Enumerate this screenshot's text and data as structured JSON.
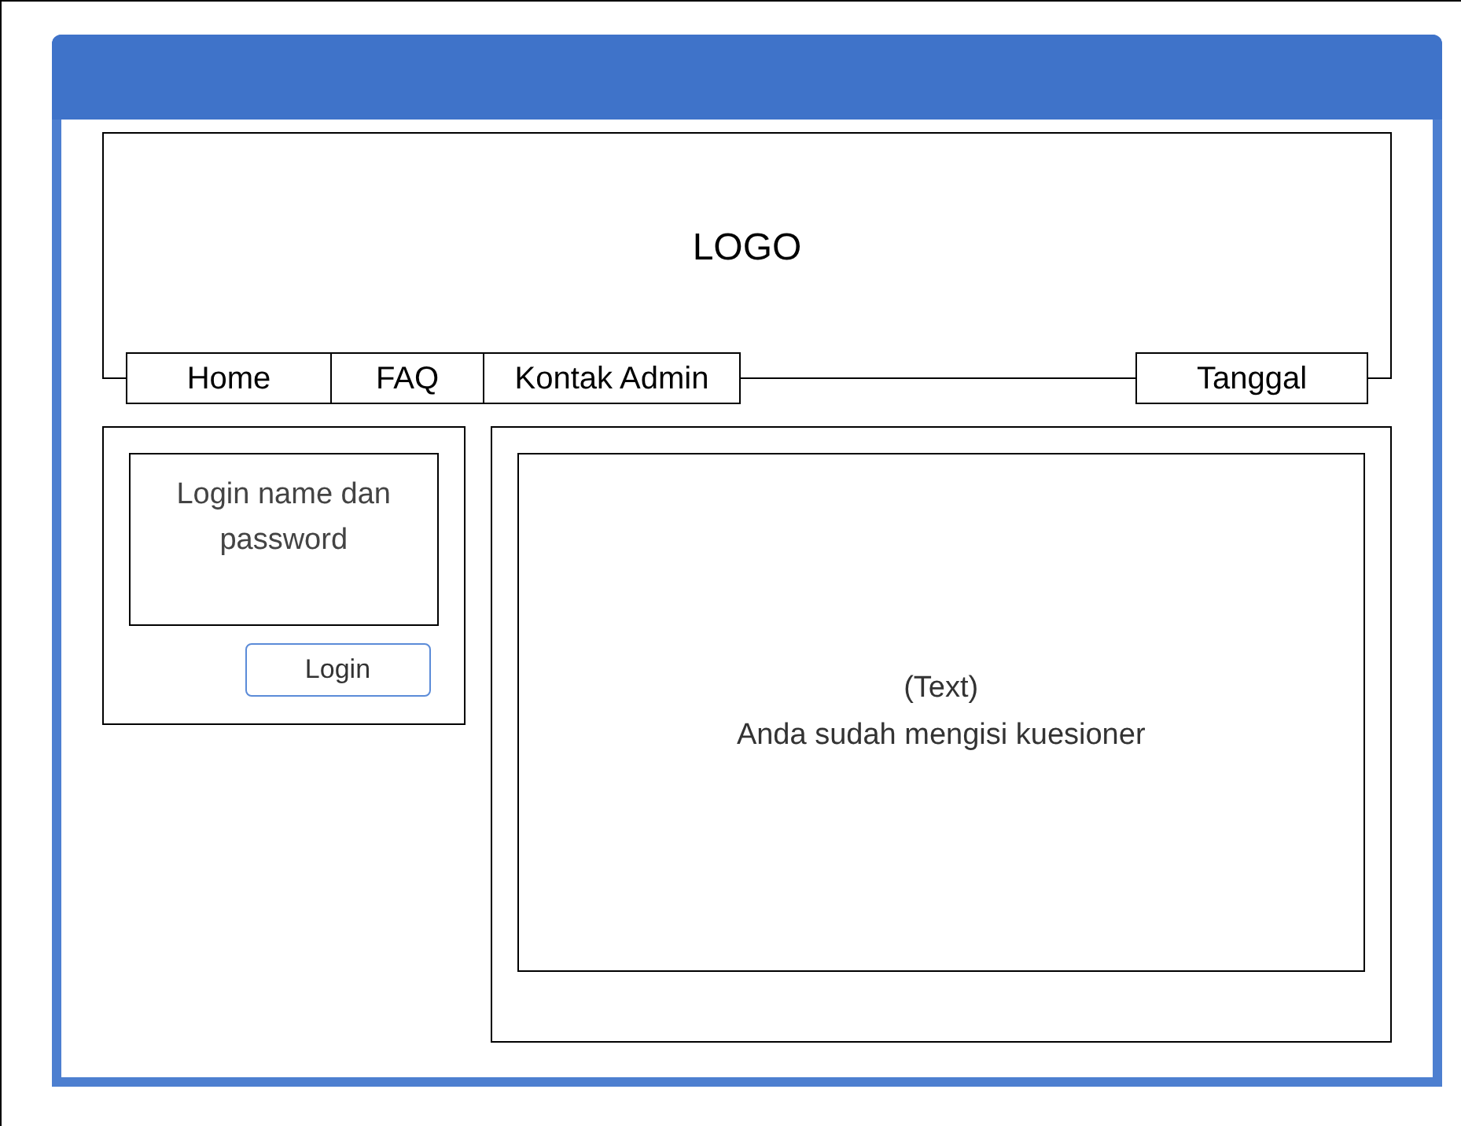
{
  "header": {
    "logo": "LOGO"
  },
  "nav": [
    {
      "label": "Home"
    },
    {
      "label": "FAQ"
    },
    {
      "label": "Kontak Admin"
    }
  ],
  "date": {
    "label": "Tanggal"
  },
  "login": {
    "placeholder": "Login name dan password",
    "button": "Login"
  },
  "content": {
    "lines": [
      "(Text)",
      "Anda sudah mengisi kuesioner"
    ]
  }
}
